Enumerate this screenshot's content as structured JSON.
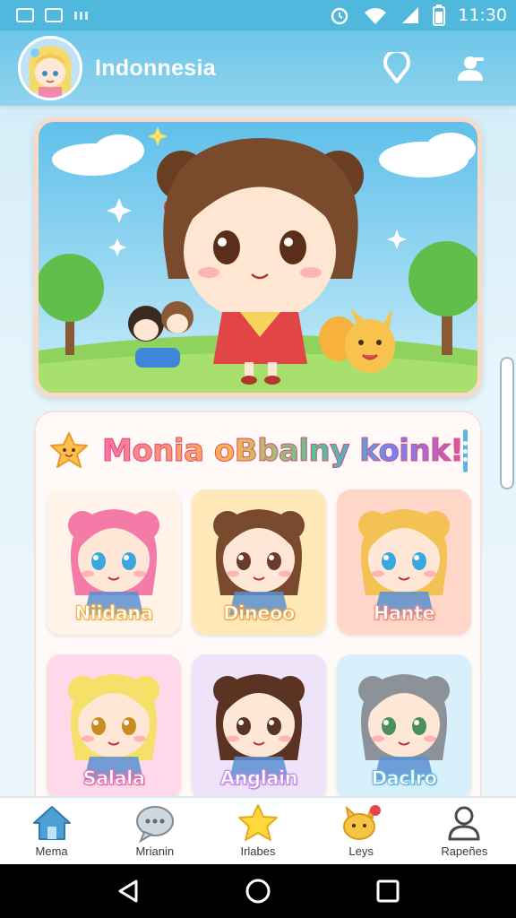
{
  "status_bar": {
    "time": "11:30",
    "left_icons": [
      "image-icon",
      "message-icon",
      "signal-text-icon"
    ],
    "right_icons": [
      "alarm-icon",
      "wifi-icon",
      "cell-signal-icon",
      "battery-icon"
    ]
  },
  "header": {
    "title": "Indonnesia",
    "actions": [
      "location-pin-icon",
      "profile-icon"
    ]
  },
  "section": {
    "title": "Monia oBbalny koink!"
  },
  "characters": [
    {
      "name": "Niidana",
      "bg": "#fff3ea",
      "name_color": "#f3b14a",
      "hair": "#f47aa8",
      "eyes": "#3ba7e0"
    },
    {
      "name": "Dineoo",
      "bg": "#ffe9b8",
      "name_color": "#f0a746",
      "hair": "#7a4a2e",
      "eyes": "#6b3b2a"
    },
    {
      "name": "Hante",
      "bg": "#ffd6c8",
      "name_color": "#f08e7c",
      "hair": "#f4c252",
      "eyes": "#3ba7e0"
    },
    {
      "name": "Salala",
      "bg": "#ffd9ea",
      "name_color": "#e66fb1",
      "hair": "#f6e06a",
      "eyes": "#c98d1f"
    },
    {
      "name": "Anglain",
      "bg": "#efe3fa",
      "name_color": "#c08be3",
      "hair": "#5a3322",
      "eyes": "#5a3322"
    },
    {
      "name": "Daclro",
      "bg": "#d8f0fb",
      "name_color": "#66b8e0",
      "hair": "#8c9298",
      "eyes": "#4b8f5d"
    }
  ],
  "bottom_nav": [
    {
      "label": "Mema",
      "icon": "home-icon"
    },
    {
      "label": "Mrianin",
      "icon": "chat-icon"
    },
    {
      "label": "Irlabes",
      "icon": "star-icon"
    },
    {
      "label": "Leys",
      "icon": "pet-icon"
    },
    {
      "label": "Rapeñes",
      "icon": "user-icon"
    }
  ],
  "colors": {
    "status_bar": "#4fb8dc",
    "header": "#6cc6e8",
    "accent": "#5ab4e6"
  }
}
